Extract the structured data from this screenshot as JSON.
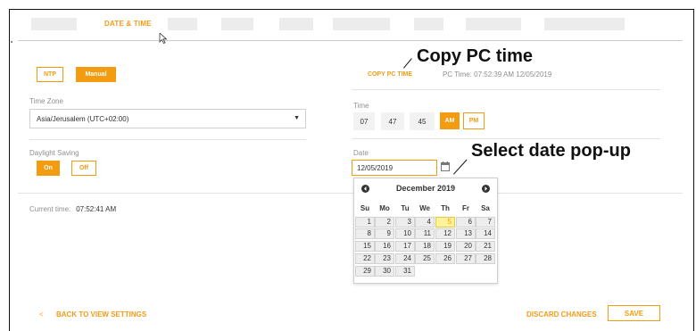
{
  "tabs": {
    "active": "DATE & TIME"
  },
  "sync": {
    "ntp_label": "NTP",
    "manual_label": "Manual"
  },
  "time_zone": {
    "label": "Time Zone",
    "value": "Asia/Jerusalem (UTC+02:00)"
  },
  "daylight": {
    "label": "Daylight Saving",
    "on_label": "On",
    "off_label": "Off"
  },
  "copy_pc": {
    "button_label": "COPY PC TIME",
    "pc_time_text": "PC Time: 07:52:39 AM 12/05/2019"
  },
  "time": {
    "label": "Time",
    "hours": "07",
    "minutes": "47",
    "seconds": "45",
    "am_label": "AM",
    "pm_label": "PM"
  },
  "date": {
    "label": "Date",
    "value": "12/05/2019"
  },
  "calendar": {
    "title": "December 2019",
    "weekdays": [
      "Su",
      "Mo",
      "Tu",
      "We",
      "Th",
      "Fr",
      "Sa"
    ],
    "weeks": [
      [
        "1",
        "2",
        "3",
        "4",
        "5",
        "6",
        "7"
      ],
      [
        "8",
        "9",
        "10",
        "11",
        "12",
        "13",
        "14"
      ],
      [
        "15",
        "16",
        "17",
        "18",
        "19",
        "20",
        "21"
      ],
      [
        "22",
        "23",
        "24",
        "25",
        "26",
        "27",
        "28"
      ],
      [
        "29",
        "30",
        "31"
      ]
    ],
    "selected_day": "5"
  },
  "current_time": {
    "label": "Current time:",
    "value": "07:52:41 AM"
  },
  "annotations": {
    "copy_pc": "Copy PC time",
    "date_popup": "Select date pop-up"
  },
  "footer": {
    "back_icon": "<",
    "back_label": "BACK TO VIEW SETTINGS",
    "discard_label": "DISCARD CHANGES",
    "save_label": "SAVE"
  },
  "colors": {
    "accent": "#f39c12",
    "selected_day_bg": "#fff39a"
  }
}
